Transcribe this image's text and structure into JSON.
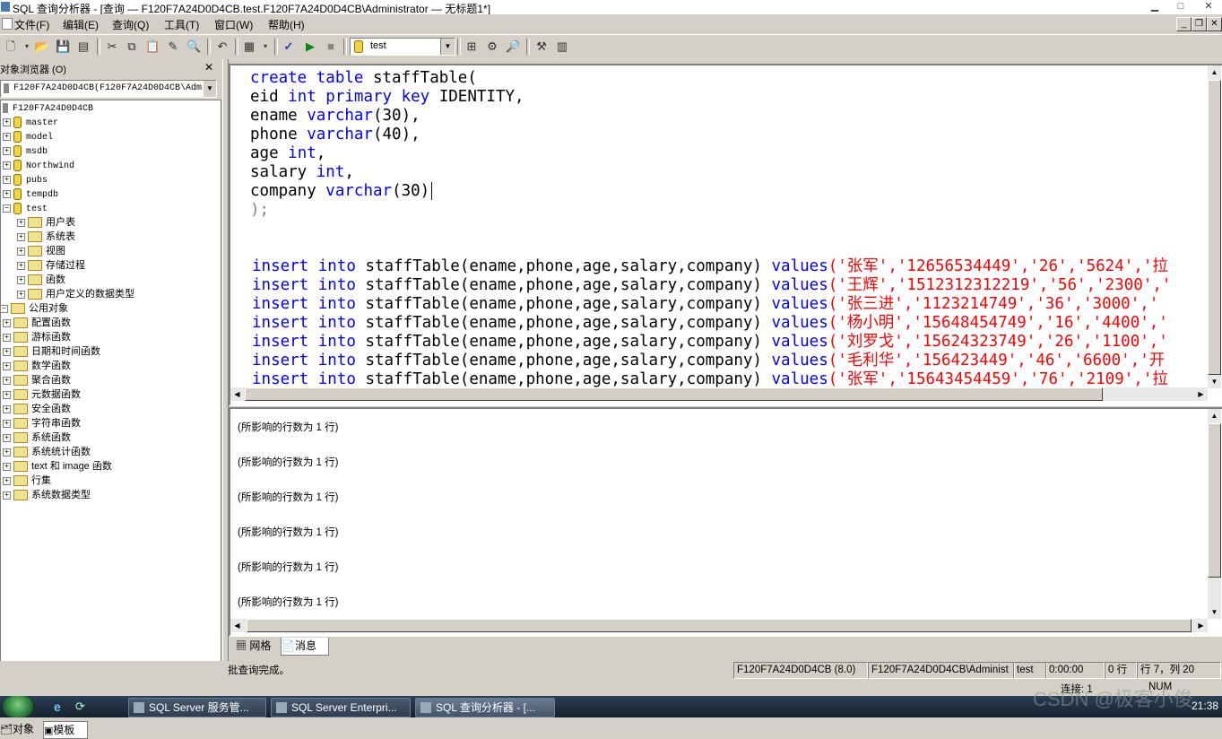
{
  "window": {
    "title": "SQL 查询分析器 - [查询 — F120F7A24D0D4CB.test.F120F7A24D0D4CB\\Administrator — 无标题1*]",
    "min": "▁",
    "max": "□",
    "close": "✕"
  },
  "menu": [
    "文件(F)",
    "编辑(E)",
    "查询(Q)",
    "工具(T)",
    "窗口(W)",
    "帮助(H)"
  ],
  "mdi": {
    "min": "_",
    "restore": "❐",
    "close": "✕"
  },
  "toolbar": {
    "database": "test"
  },
  "object_browser": {
    "title": "对象浏览器 (O)",
    "close": "✕",
    "server_combo": "F120F7A24D0D4CB(F120F7A24D0D4CB\\Adm",
    "tree": {
      "server": "F120F7A24D0D4CB",
      "databases": [
        "master",
        "model",
        "msdb",
        "Northwind",
        "pubs",
        "tempdb",
        "test"
      ],
      "test_children": [
        "用户表",
        "系统表",
        "视图",
        "存储过程",
        "函数",
        "用户定义的数据类型"
      ],
      "common_root": "公用对象",
      "common_children": [
        "配置函数",
        "游标函数",
        "日期和时间函数",
        "数学函数",
        "聚合函数",
        "元数据函数",
        "安全函数",
        "字符串函数",
        "系统函数",
        "系统统计函数",
        "text 和 image 函数",
        "行集",
        "系统数据类型"
      ]
    },
    "tabs": [
      "对象",
      "模板"
    ]
  },
  "editor": {
    "create_lines": [
      [
        "create table",
        " staffTable("
      ],
      [
        "eid ",
        "int primary key",
        " IDENTITY,"
      ],
      [
        "ename ",
        "varchar",
        "(30),"
      ],
      [
        "phone ",
        "varchar",
        "(40),"
      ],
      [
        "age ",
        "int",
        ","
      ],
      [
        "salary ",
        "int",
        ","
      ],
      [
        "company ",
        "varchar",
        "(30)"
      ],
      [
        ");"
      ]
    ],
    "insert": {
      "kw1": "insert",
      "kw2": "into",
      "body": " staffTable(ename,phone,age,salary,company) ",
      "kw3": "values",
      "rows": [
        "('张军','12656534449','26','5624','拉",
        "('王辉','1512312312219','56','2300','",
        "('张三进','1123214749','36','3000','",
        "('杨小明','15648454749','16','4400','",
        "('刘罗戈','15624323749','26','1100','",
        "('毛利华','156423449','46','6600','开",
        "('张军','15643454459','76','2109','拉"
      ]
    }
  },
  "results": {
    "messages": [
      "(所影响的行数为 1 行)",
      "(所影响的行数为 1 行)",
      "(所影响的行数为 1 行)",
      "(所影响的行数为 1 行)",
      "(所影响的行数为 1 行)",
      "(所影响的行数为 1 行)"
    ],
    "tabs": [
      "网格",
      "消息"
    ]
  },
  "status": {
    "message": "批查询完成。",
    "server": "F120F7A24D0D4CB (8.0)",
    "user": "F120F7A24D0D4CB\\Administ",
    "db": "test",
    "time": "0:00:00",
    "rows": "0 行",
    "position": "行 7，列 20",
    "connections": "连接: 1",
    "num": "NUM"
  },
  "taskbar": {
    "tasks": [
      "SQL Server 服务管...",
      "SQL Server Enterpri...",
      "SQL 查询分析器 - [..."
    ],
    "clock": "21:38",
    "watermark": "CSDN @极客小俊"
  }
}
